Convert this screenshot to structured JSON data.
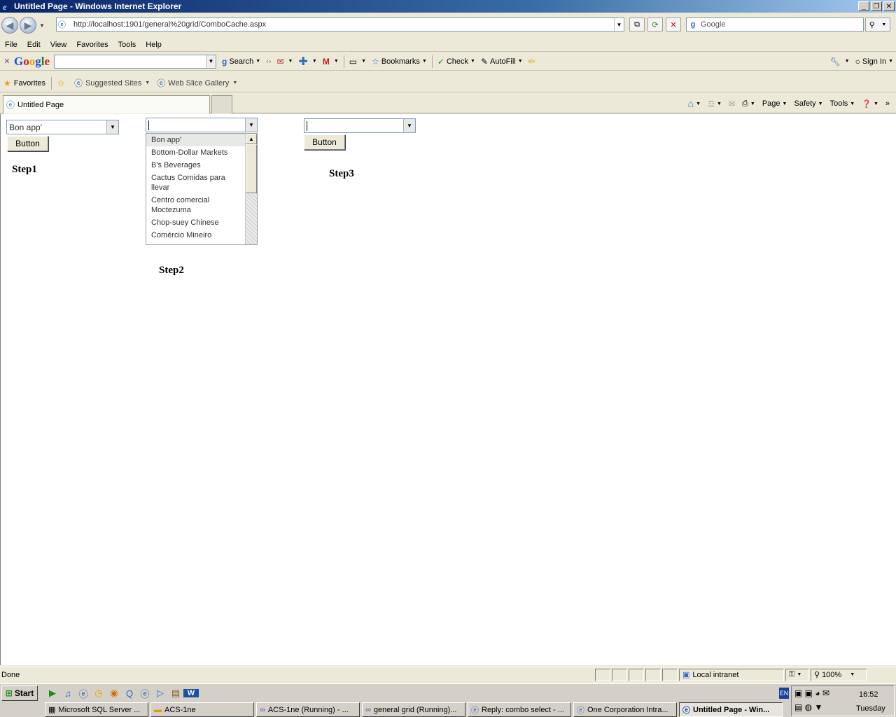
{
  "window": {
    "title": "Untitled Page - Windows Internet Explorer",
    "minimize_glyph": "_",
    "restore_glyph": "❐",
    "close_glyph": "✕"
  },
  "address": {
    "url": "http://localhost:1901/general%20grid/ComboCache.aspx",
    "search_placeholder": "Google"
  },
  "menu": [
    "File",
    "Edit",
    "View",
    "Favorites",
    "Tools",
    "Help"
  ],
  "google_toolbar": {
    "logo_letters": [
      "G",
      "o",
      "o",
      "g",
      "l",
      "e"
    ],
    "search_label": "Search",
    "bookmarks_label": "Bookmarks",
    "check_label": "Check",
    "autofill_label": "AutoFill",
    "signin_label": "Sign In"
  },
  "favorites_bar": {
    "favorites_label": "Favorites",
    "suggested_sites_label": "Suggested Sites",
    "web_slice_label": "Web Slice Gallery"
  },
  "tabs": {
    "active_tab_label": "Untitled Page"
  },
  "command_bar": {
    "page_label": "Page",
    "safety_label": "Safety",
    "tools_label": "Tools"
  },
  "page": {
    "step1": {
      "combo_value": "Bon app'",
      "button_label": "Button",
      "label": "Step1"
    },
    "step2": {
      "combo_value": "",
      "label": "Step2",
      "list_items": [
        "Bon app'",
        "Bottom-Dollar Markets",
        "B's Beverages",
        "Cactus Comidas para llevar",
        "Centro comercial Moctezuma",
        "Chop-suey Chinese",
        "Comércio Mineiro"
      ]
    },
    "step3": {
      "combo_value": "",
      "button_label": "Button",
      "label": "Step3"
    }
  },
  "status_bar": {
    "status_text": "Done",
    "zone_label": "Local intranet",
    "zoom": "100%"
  },
  "taskbar": {
    "start_label": "Start",
    "tasks": [
      {
        "label": "Microsoft SQL Server ...",
        "icon": "sql-icon"
      },
      {
        "label": "ACS-1ne",
        "icon": "folder-icon"
      },
      {
        "label": "ACS-1ne (Running) - ...",
        "icon": "vs-icon"
      },
      {
        "label": "general grid (Running)...",
        "icon": "vs-icon"
      },
      {
        "label": "Reply: combo select - ...",
        "icon": "ie-icon"
      },
      {
        "label": "One Corporation Intra...",
        "icon": "ie-icon"
      },
      {
        "label": "Untitled Page - Win...",
        "icon": "ie-icon"
      }
    ],
    "language": "EN",
    "time": "16:52",
    "day": "Tuesday"
  }
}
